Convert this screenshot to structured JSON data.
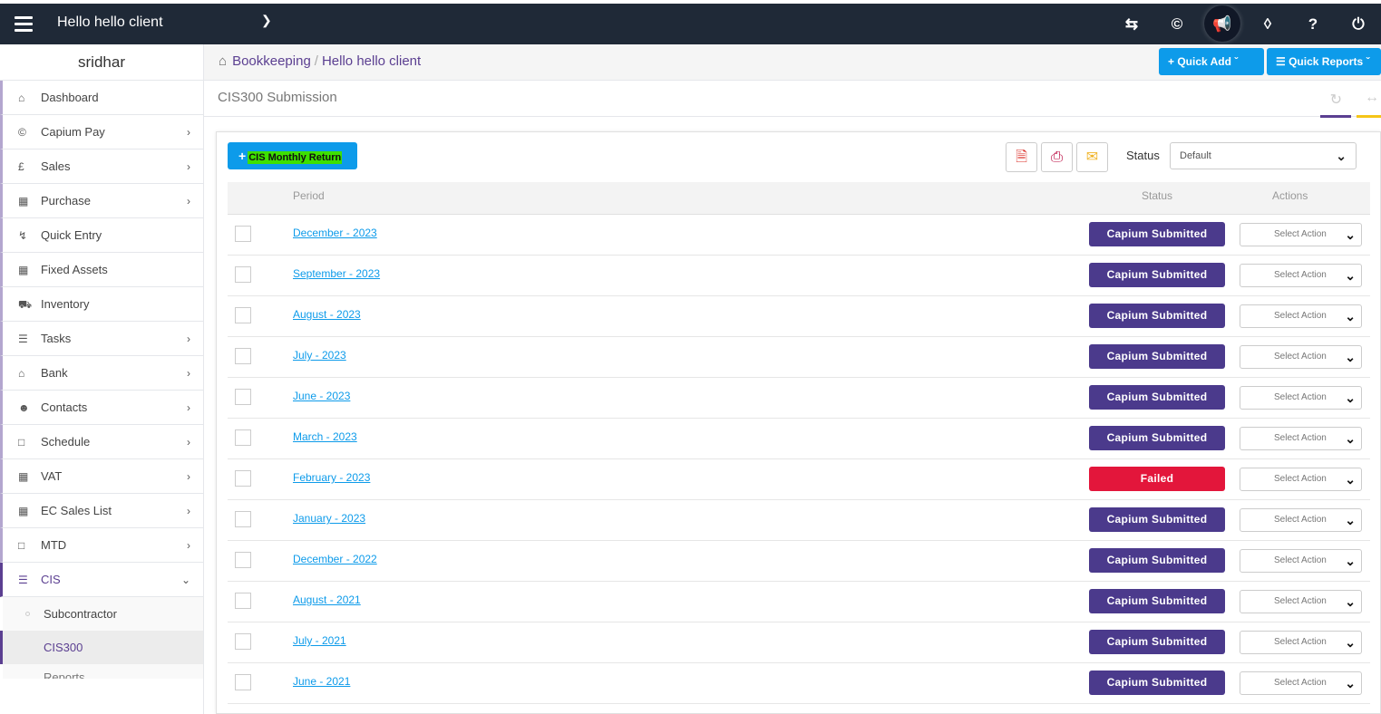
{
  "topbar": {
    "client_name": "Hello hello client",
    "icons": [
      "switch-icon",
      "capium-icon",
      "megaphone-icon",
      "ticket-icon",
      "help-icon",
      "power-icon"
    ]
  },
  "sidebar": {
    "user": "sridhar",
    "items": [
      {
        "label": "Dashboard",
        "icon": "home-icon",
        "arrow": false
      },
      {
        "label": "Capium Pay",
        "icon": "capium-icon",
        "arrow": true
      },
      {
        "label": "Sales",
        "icon": "pound-icon",
        "arrow": true
      },
      {
        "label": "Purchase",
        "icon": "purchase-icon",
        "arrow": true
      },
      {
        "label": "Quick Entry",
        "icon": "bolt-icon",
        "arrow": false
      },
      {
        "label": "Fixed Assets",
        "icon": "building-icon",
        "arrow": false
      },
      {
        "label": "Inventory",
        "icon": "truck-icon",
        "arrow": false
      },
      {
        "label": "Tasks",
        "icon": "tasks-icon",
        "arrow": true
      },
      {
        "label": "Bank",
        "icon": "bank-icon",
        "arrow": true
      },
      {
        "label": "Contacts",
        "icon": "users-icon",
        "arrow": true
      },
      {
        "label": "Schedule",
        "icon": "calendar-icon",
        "arrow": true
      },
      {
        "label": "VAT",
        "icon": "calculator-icon",
        "arrow": true
      },
      {
        "label": "EC Sales List",
        "icon": "calculator-icon",
        "arrow": true
      },
      {
        "label": "MTD",
        "icon": "calendar-icon",
        "arrow": true
      },
      {
        "label": "CIS",
        "icon": "list-icon",
        "arrow": true
      }
    ],
    "cis_sub": [
      "Subcontractor",
      "CIS300",
      "Reports"
    ]
  },
  "breadcrumb": {
    "root": "Bookkeeping",
    "current": "Hello hello client"
  },
  "quick_add": "Quick Add",
  "quick_reports": "Quick Reports",
  "page_title": "CIS300 Submission",
  "toolbar": {
    "cis_monthly_return": "CIS Monthly Return",
    "status_label": "Status",
    "status_value": "Default"
  },
  "table": {
    "headers": {
      "period": "Period",
      "status": "Status",
      "actions": "Actions"
    },
    "action_placeholder": "Select Action",
    "rows": [
      {
        "period": "December - 2023",
        "status": "Capium Submitted"
      },
      {
        "period": "September - 2023",
        "status": "Capium Submitted"
      },
      {
        "period": "August - 2023",
        "status": "Capium Submitted"
      },
      {
        "period": "July - 2023",
        "status": "Capium Submitted"
      },
      {
        "period": "June - 2023",
        "status": "Capium Submitted"
      },
      {
        "period": "March - 2023",
        "status": "Capium Submitted"
      },
      {
        "period": "February - 2023",
        "status": "Failed"
      },
      {
        "period": "January - 2023",
        "status": "Capium Submitted"
      },
      {
        "period": "December - 2022",
        "status": "Capium Submitted"
      },
      {
        "period": "August - 2021",
        "status": "Capium Submitted"
      },
      {
        "period": "July - 2021",
        "status": "Capium Submitted"
      },
      {
        "period": "June - 2021",
        "status": "Capium Submitted"
      }
    ]
  },
  "colors": {
    "accent": "#5b3f91",
    "primary": "#0d9bea",
    "submitted": "#4b3a8c",
    "failed": "#e3163b",
    "topbar": "#1f2937"
  }
}
